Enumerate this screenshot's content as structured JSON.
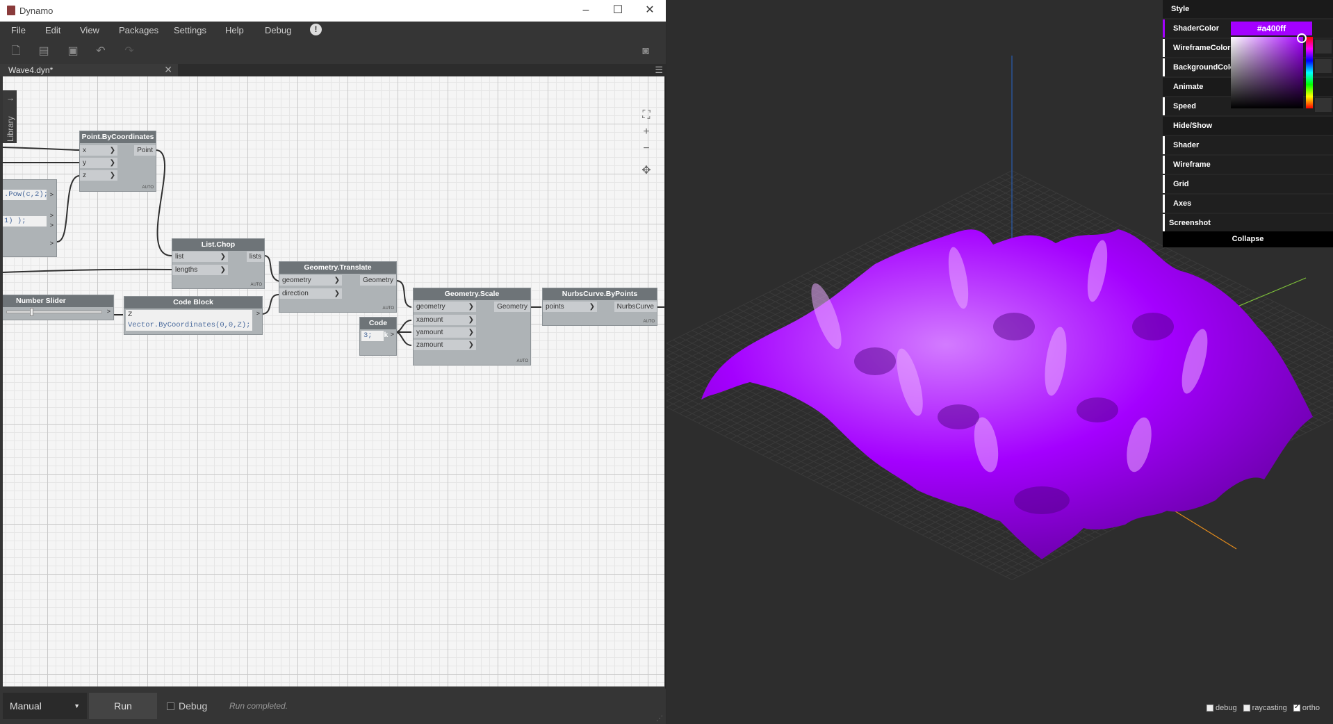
{
  "window": {
    "title": "Dynamo",
    "controls": [
      "minimize-icon",
      "maximize-icon",
      "close-icon"
    ]
  },
  "menu": [
    "File",
    "Edit",
    "View",
    "Packages",
    "Settings",
    "Help",
    "Debug"
  ],
  "toolbar": {
    "icons": [
      "new-file-icon",
      "open-file-icon",
      "save-icon",
      "undo-icon",
      "redo-icon",
      "camera-icon"
    ]
  },
  "tab": {
    "label": "Wave4.dyn*"
  },
  "library": {
    "label": "Library"
  },
  "nodes": {
    "point": {
      "title": "Point.ByCoordinates",
      "inputs": [
        "x",
        "y",
        "z"
      ],
      "output": "Point",
      "mode": "AUTO"
    },
    "partial_code": {
      "line1": ".Pow(c,2);",
      "line2": "1) );"
    },
    "listchop": {
      "title": "List.Chop",
      "inputs": [
        "list",
        "lengths"
      ],
      "output": "lists",
      "mode": "AUTO"
    },
    "translate": {
      "title": "Geometry.Translate",
      "inputs": [
        "geometry",
        "direction"
      ],
      "output": "Geometry",
      "mode": "AUTO"
    },
    "scale": {
      "title": "Geometry.Scale",
      "inputs": [
        "geometry",
        "xamount",
        "yamount",
        "zamount"
      ],
      "output": "Geometry",
      "mode": "AUTO"
    },
    "nurbs": {
      "title": "NurbsCurve.ByPoints",
      "inputs": [
        "points"
      ],
      "output": "NurbsCurve",
      "mode": "AUTO"
    },
    "slider": {
      "title": "Number Slider"
    },
    "codeblock1": {
      "title": "Code Block",
      "code_prefix": "Z",
      "code": "Vector.ByCoordinates(0,0,Z);"
    },
    "codeblock2": {
      "title": "Code Block",
      "code": "3;"
    }
  },
  "bottom": {
    "run_mode": "Manual",
    "run_button": "Run",
    "debug_label": "Debug",
    "status": "Run completed."
  },
  "viewer_panel": {
    "rows": [
      "Style",
      "ShaderColor",
      "WireframeColor",
      "BackgroundColor",
      "Animate",
      "Speed",
      "Hide/Show",
      "Shader",
      "Wireframe",
      "Grid",
      "Axes",
      "Screenshot"
    ],
    "shader_color": "#a400ff",
    "collapse": "Collapse"
  },
  "viewer_flags": {
    "debug": {
      "label": "debug",
      "checked": false
    },
    "raycasting": {
      "label": "raycasting",
      "checked": false
    },
    "ortho": {
      "label": "ortho",
      "checked": true
    }
  },
  "colors": {
    "accent": "#a400ff",
    "canvas_bg": "#f5f5f5",
    "node_header": "#6e7478"
  }
}
